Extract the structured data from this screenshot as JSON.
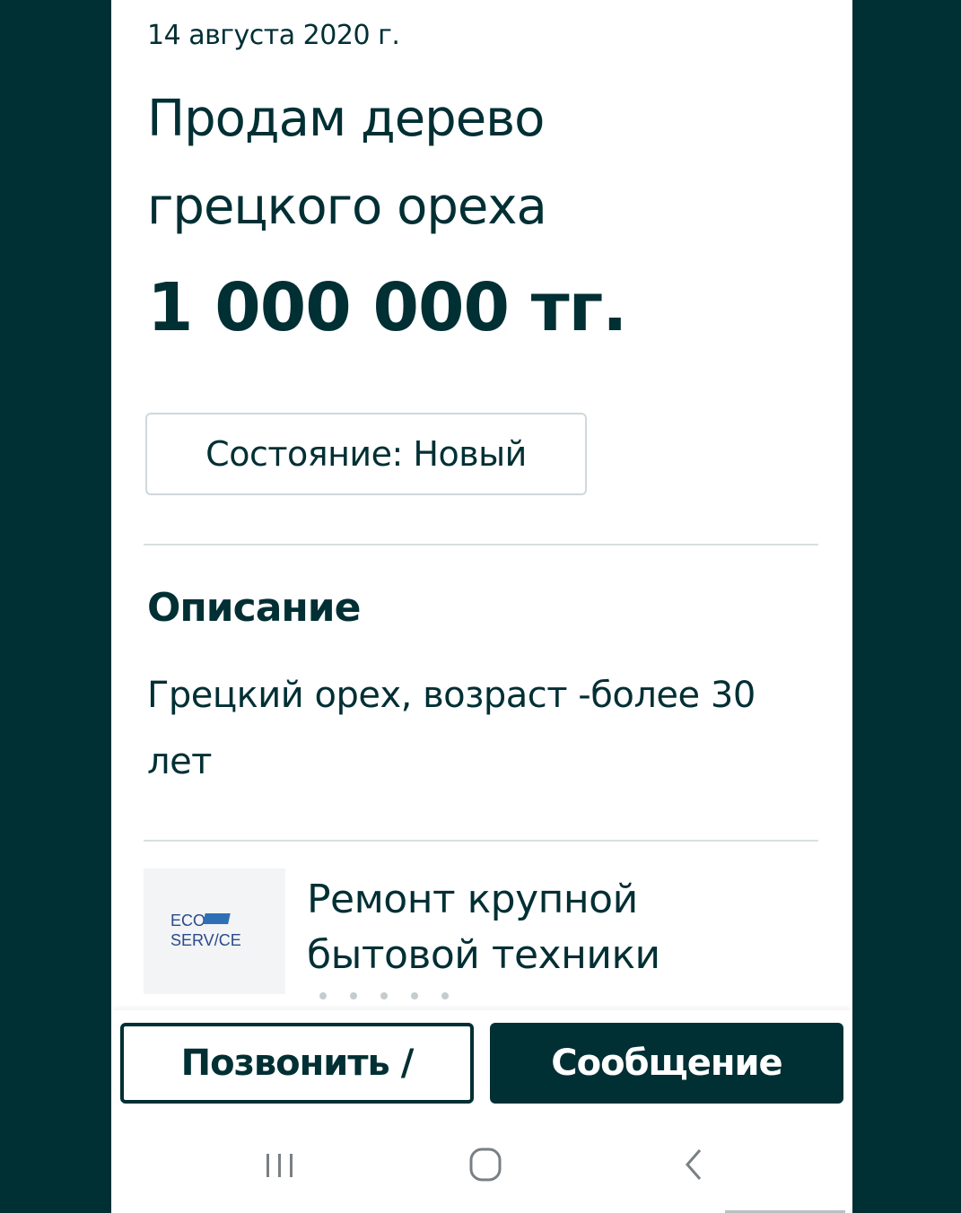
{
  "listing": {
    "date": "14 августа 2020 г.",
    "title": "Продам дерево грецкого ореха",
    "price": "1 000 000 тг.",
    "condition": "Состояние: Новый"
  },
  "description": {
    "heading": "Описание",
    "text": "Грецкий орех, возраст -более 30 лет"
  },
  "ad": {
    "logo_text_top": "ECO",
    "logo_text_bottom": "SERV/CE",
    "text": "Ремонт крупной бытовой техники"
  },
  "actions": {
    "call_label": "Позвонить /",
    "message_label": "Сообщение"
  },
  "system_nav": {
    "recent_icon": "recent-apps-icon",
    "home_icon": "home-icon",
    "back_icon": "back-icon"
  },
  "colors": {
    "brand_dark": "#002f34",
    "background_outer": "#002f34",
    "divider": "#d8dfe0"
  }
}
